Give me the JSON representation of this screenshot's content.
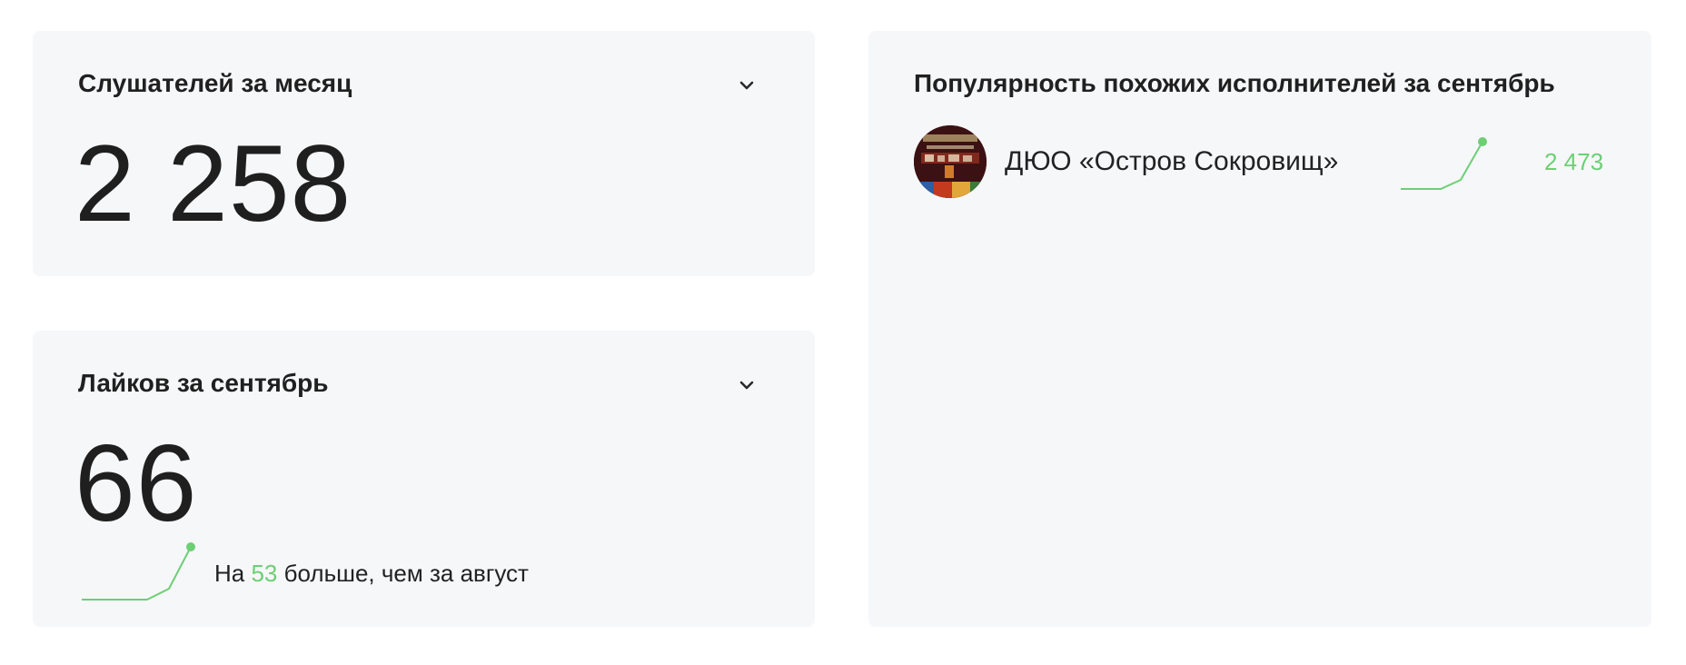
{
  "colors": {
    "card_bg": "#f6f7f9",
    "accent_green": "#6ccf74",
    "text": "#1f1f1f"
  },
  "listeners_card": {
    "title": "Слушателей за месяц",
    "value": "2 258",
    "toggle_icon": "chevron-down-icon"
  },
  "likes_card": {
    "title": "Лайков за сентябрь",
    "value": "66",
    "toggle_icon": "chevron-down-icon",
    "comparison": {
      "prefix": "На ",
      "delta": "53",
      "suffix": " больше, чем за август"
    },
    "trend_icon": "sparkline-up"
  },
  "similar_card": {
    "title": "Популярность похожих исполнителей за сентябрь",
    "artists": [
      {
        "name": "ДЮО «Остров Сокровищ»",
        "value": "2 473",
        "avatar_icon": "artist-avatar",
        "trend_icon": "sparkline-up"
      }
    ]
  }
}
